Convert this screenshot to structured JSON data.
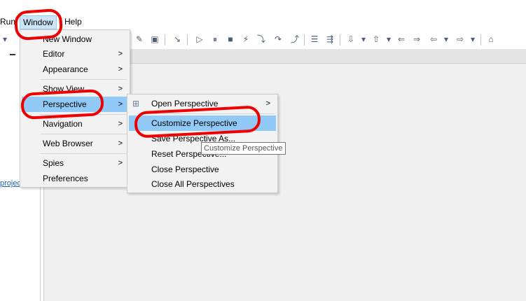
{
  "menubar": {
    "run_label": "Run",
    "window_label": "Window",
    "help_label": "Help"
  },
  "left_panel": {
    "project_link": "projec"
  },
  "window_menu": {
    "items": [
      {
        "label": "New Window",
        "submenu": false
      },
      {
        "label": "Editor",
        "submenu": true
      },
      {
        "label": "Appearance",
        "submenu": true
      },
      {
        "label": "Show View",
        "submenu": true
      },
      {
        "label": "Perspective",
        "submenu": true
      },
      {
        "label": "Navigation",
        "submenu": true
      },
      {
        "label": "Web Browser",
        "submenu": true
      },
      {
        "label": "Spies",
        "submenu": true
      },
      {
        "label": "Preferences",
        "submenu": false
      }
    ],
    "arrow": ">"
  },
  "perspective_menu": {
    "items": [
      {
        "label": "Open Perspective",
        "submenu": true
      },
      {
        "label": "Customize Perspective",
        "submenu": false
      },
      {
        "label": "Save Perspective As...",
        "submenu": false
      },
      {
        "label": "Reset Perspective...",
        "submenu": false
      },
      {
        "label": "Close Perspective",
        "submenu": false
      },
      {
        "label": "Close All Perspectives",
        "submenu": false
      }
    ],
    "arrow": ">"
  },
  "tooltip": {
    "text": "Customize Perspective"
  },
  "colors": {
    "highlight": "#91c9f7",
    "annotation": "#ee0000"
  }
}
